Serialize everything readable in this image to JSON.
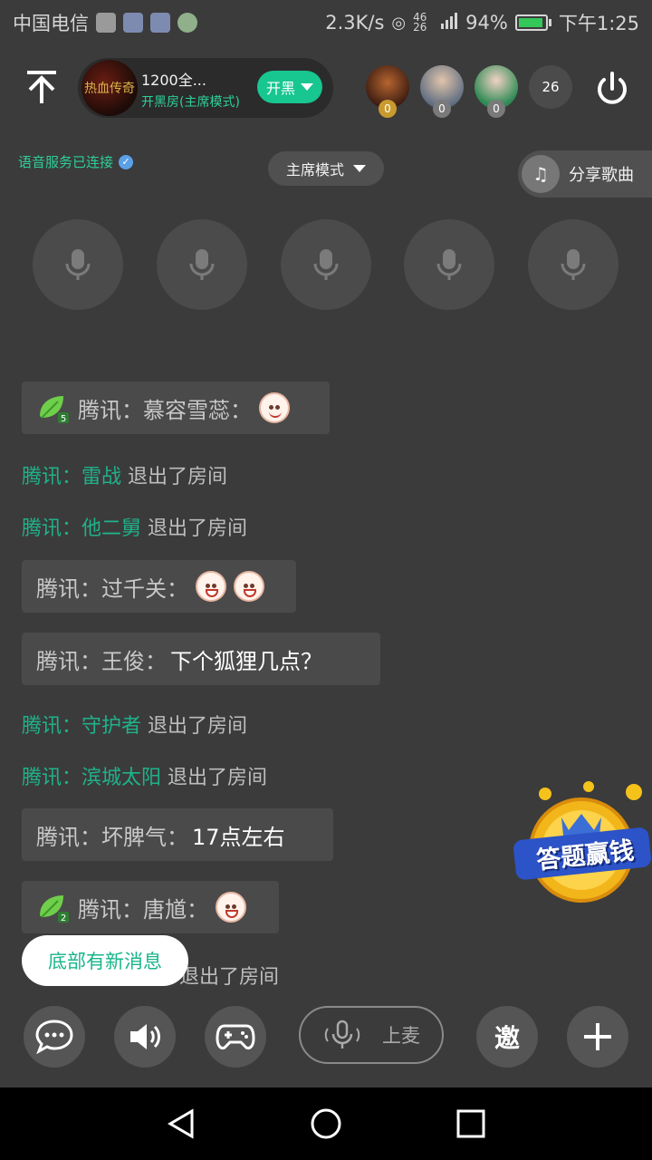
{
  "status_bar": {
    "carrier": "中国电信",
    "speed": "2.3K/s",
    "network": "46 26",
    "battery": "94%",
    "time": "下午1:25"
  },
  "header": {
    "room_name": "1200全...",
    "room_sub": "开黑房(主席模式)",
    "room_avatar_text": "热血传奇",
    "open_button": "开黑",
    "members": [
      {
        "badge": "0",
        "color": "#7a4a2a"
      },
      {
        "badge": "0",
        "color": "#c8b6a0"
      },
      {
        "badge": "0",
        "color": "#3f8f5a"
      }
    ],
    "member_count": "26"
  },
  "subbar": {
    "voice_status": "语音服务已连接",
    "mode": "主席模式",
    "share_song": "分享歌曲"
  },
  "seats": [
    "seat-1",
    "seat-2",
    "seat-3",
    "seat-4",
    "seat-5"
  ],
  "chat": {
    "m1": {
      "leaf_level": "5",
      "text": "腾讯：慕容雪蕊："
    },
    "s1": {
      "who": "腾讯：雷战",
      "action": " 退出了房间"
    },
    "s2": {
      "who": "腾讯：他二舅",
      "action": " 退出了房间"
    },
    "m2": {
      "text": "腾讯：过千关："
    },
    "m3": {
      "text": "腾讯：王俊：",
      "msg": "下个狐狸几点？"
    },
    "s3": {
      "who": "腾讯：守护者",
      "action": " 退出了房间"
    },
    "s4": {
      "who": "腾讯：滨城太阳",
      "action": " 退出了房间"
    },
    "m4": {
      "text": "腾讯：坏脾气：",
      "msg": "17点左右"
    },
    "m5": {
      "leaf_level": "2",
      "text": "腾讯：唐馗："
    },
    "s5": {
      "action": "退出了房间"
    }
  },
  "new_message_toast": "底部有新消息",
  "quiz_badge": "答题赢钱",
  "toolbar": {
    "mic_label": "上麦",
    "invite_label": "邀"
  },
  "colors": {
    "accent": "#18c690",
    "background": "#3b3b3b",
    "bubble": "#4a4a4a"
  }
}
